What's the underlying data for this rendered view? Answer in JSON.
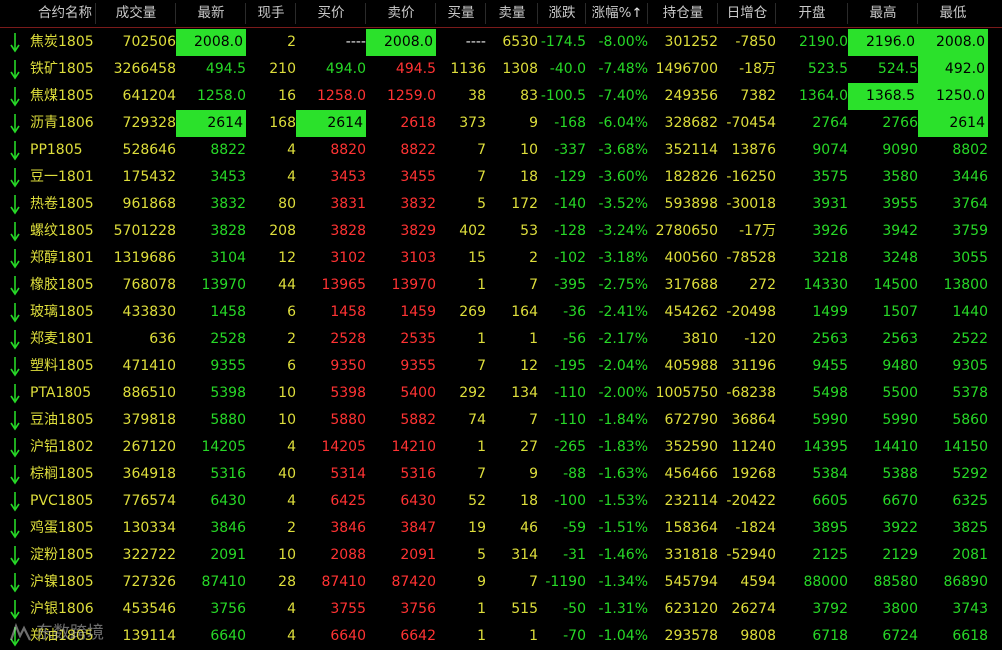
{
  "header": {
    "columns": [
      "合约名称",
      "成交量",
      "最新",
      "现手",
      "买价",
      "卖价",
      "买量",
      "卖量",
      "涨跌",
      "涨幅%",
      "持仓量",
      "日增仓",
      "开盘",
      "最高",
      "最低"
    ],
    "sort_indicator": "↑"
  },
  "rows": [
    {
      "name": "焦炭1805",
      "vol": "702506",
      "last": "2008.0",
      "hand": "2",
      "bid": "----",
      "ask": "2008.0",
      "bidv": "----",
      "askv": "6530",
      "chg": "-174.5",
      "pct": "-8.00%",
      "oi": "301252",
      "doi": "-7850",
      "open": "2190.0",
      "high": "2196.0",
      "low": "2008.0"
    },
    {
      "name": "铁矿1805",
      "vol": "3266458",
      "last": "494.5",
      "hand": "210",
      "bid": "494.0",
      "ask": "494.5",
      "bidv": "1136",
      "askv": "1308",
      "chg": "-40.0",
      "pct": "-7.48%",
      "oi": "1496700",
      "doi": "-18万",
      "open": "523.5",
      "high": "524.5",
      "low": "492.0"
    },
    {
      "name": "焦煤1805",
      "vol": "641204",
      "last": "1258.0",
      "hand": "16",
      "bid": "1258.0",
      "ask": "1259.0",
      "bidv": "38",
      "askv": "83",
      "chg": "-100.5",
      "pct": "-7.40%",
      "oi": "249356",
      "doi": "7382",
      "open": "1364.0",
      "high": "1368.5",
      "low": "1250.0"
    },
    {
      "name": "沥青1806",
      "vol": "729328",
      "last": "2614",
      "hand": "168",
      "bid": "2614",
      "ask": "2618",
      "bidv": "373",
      "askv": "9",
      "chg": "-168",
      "pct": "-6.04%",
      "oi": "328682",
      "doi": "-70454",
      "open": "2764",
      "high": "2766",
      "low": "2614"
    },
    {
      "name": "PP1805",
      "vol": "528646",
      "last": "8822",
      "hand": "4",
      "bid": "8820",
      "ask": "8822",
      "bidv": "7",
      "askv": "10",
      "chg": "-337",
      "pct": "-3.68%",
      "oi": "352114",
      "doi": "13876",
      "open": "9074",
      "high": "9090",
      "low": "8802"
    },
    {
      "name": "豆一1801",
      "vol": "175432",
      "last": "3453",
      "hand": "4",
      "bid": "3453",
      "ask": "3455",
      "bidv": "7",
      "askv": "18",
      "chg": "-129",
      "pct": "-3.60%",
      "oi": "182826",
      "doi": "-16250",
      "open": "3575",
      "high": "3580",
      "low": "3446"
    },
    {
      "name": "热卷1805",
      "vol": "961868",
      "last": "3832",
      "hand": "80",
      "bid": "3831",
      "ask": "3832",
      "bidv": "5",
      "askv": "172",
      "chg": "-140",
      "pct": "-3.52%",
      "oi": "593898",
      "doi": "-30018",
      "open": "3931",
      "high": "3955",
      "low": "3764"
    },
    {
      "name": "螺纹1805",
      "vol": "5701228",
      "last": "3828",
      "hand": "208",
      "bid": "3828",
      "ask": "3829",
      "bidv": "402",
      "askv": "53",
      "chg": "-128",
      "pct": "-3.24%",
      "oi": "2780650",
      "doi": "-17万",
      "open": "3926",
      "high": "3942",
      "low": "3759"
    },
    {
      "name": "郑醇1801",
      "vol": "1319686",
      "last": "3104",
      "hand": "12",
      "bid": "3102",
      "ask": "3103",
      "bidv": "15",
      "askv": "2",
      "chg": "-102",
      "pct": "-3.18%",
      "oi": "400560",
      "doi": "-78528",
      "open": "3218",
      "high": "3248",
      "low": "3055"
    },
    {
      "name": "橡胶1805",
      "vol": "768078",
      "last": "13970",
      "hand": "44",
      "bid": "13965",
      "ask": "13970",
      "bidv": "1",
      "askv": "7",
      "chg": "-395",
      "pct": "-2.75%",
      "oi": "317688",
      "doi": "272",
      "open": "14330",
      "high": "14500",
      "low": "13800"
    },
    {
      "name": "玻璃1805",
      "vol": "433830",
      "last": "1458",
      "hand": "6",
      "bid": "1458",
      "ask": "1459",
      "bidv": "269",
      "askv": "164",
      "chg": "-36",
      "pct": "-2.41%",
      "oi": "454262",
      "doi": "-20498",
      "open": "1499",
      "high": "1507",
      "low": "1440"
    },
    {
      "name": "郑麦1801",
      "vol": "636",
      "last": "2528",
      "hand": "2",
      "bid": "2528",
      "ask": "2535",
      "bidv": "1",
      "askv": "1",
      "chg": "-56",
      "pct": "-2.17%",
      "oi": "3810",
      "doi": "-120",
      "open": "2563",
      "high": "2563",
      "low": "2522"
    },
    {
      "name": "塑料1805",
      "vol": "471410",
      "last": "9355",
      "hand": "6",
      "bid": "9350",
      "ask": "9355",
      "bidv": "7",
      "askv": "12",
      "chg": "-195",
      "pct": "-2.04%",
      "oi": "405988",
      "doi": "31196",
      "open": "9455",
      "high": "9480",
      "low": "9305"
    },
    {
      "name": "PTA1805",
      "vol": "886510",
      "last": "5398",
      "hand": "10",
      "bid": "5398",
      "ask": "5400",
      "bidv": "292",
      "askv": "134",
      "chg": "-110",
      "pct": "-2.00%",
      "oi": "1005750",
      "doi": "-68238",
      "open": "5498",
      "high": "5500",
      "low": "5378"
    },
    {
      "name": "豆油1805",
      "vol": "379818",
      "last": "5880",
      "hand": "10",
      "bid": "5880",
      "ask": "5882",
      "bidv": "74",
      "askv": "7",
      "chg": "-110",
      "pct": "-1.84%",
      "oi": "672790",
      "doi": "36864",
      "open": "5990",
      "high": "5990",
      "low": "5860"
    },
    {
      "name": "沪铝1802",
      "vol": "267120",
      "last": "14205",
      "hand": "4",
      "bid": "14205",
      "ask": "14210",
      "bidv": "1",
      "askv": "27",
      "chg": "-265",
      "pct": "-1.83%",
      "oi": "352590",
      "doi": "11240",
      "open": "14395",
      "high": "14410",
      "low": "14150"
    },
    {
      "name": "棕榈1805",
      "vol": "364918",
      "last": "5316",
      "hand": "40",
      "bid": "5314",
      "ask": "5316",
      "bidv": "7",
      "askv": "9",
      "chg": "-88",
      "pct": "-1.63%",
      "oi": "456466",
      "doi": "19268",
      "open": "5384",
      "high": "5388",
      "low": "5292"
    },
    {
      "name": "PVC1805",
      "vol": "776574",
      "last": "6430",
      "hand": "4",
      "bid": "6425",
      "ask": "6430",
      "bidv": "52",
      "askv": "18",
      "chg": "-100",
      "pct": "-1.53%",
      "oi": "232114",
      "doi": "-20422",
      "open": "6605",
      "high": "6670",
      "low": "6325"
    },
    {
      "name": "鸡蛋1805",
      "vol": "130334",
      "last": "3846",
      "hand": "2",
      "bid": "3846",
      "ask": "3847",
      "bidv": "19",
      "askv": "46",
      "chg": "-59",
      "pct": "-1.51%",
      "oi": "158364",
      "doi": "-1824",
      "open": "3895",
      "high": "3922",
      "low": "3825"
    },
    {
      "name": "淀粉1805",
      "vol": "322722",
      "last": "2091",
      "hand": "10",
      "bid": "2088",
      "ask": "2091",
      "bidv": "5",
      "askv": "314",
      "chg": "-31",
      "pct": "-1.46%",
      "oi": "331818",
      "doi": "-52940",
      "open": "2125",
      "high": "2129",
      "low": "2081"
    },
    {
      "name": "沪镍1805",
      "vol": "727326",
      "last": "87410",
      "hand": "28",
      "bid": "87410",
      "ask": "87420",
      "bidv": "9",
      "askv": "7",
      "chg": "-1190",
      "pct": "-1.34%",
      "oi": "545794",
      "doi": "4594",
      "open": "88000",
      "high": "88580",
      "low": "86890"
    },
    {
      "name": "沪银1806",
      "vol": "453546",
      "last": "3756",
      "hand": "4",
      "bid": "3755",
      "ask": "3756",
      "bidv": "1",
      "askv": "515",
      "chg": "-50",
      "pct": "-1.31%",
      "oi": "623120",
      "doi": "26274",
      "open": "3792",
      "high": "3800",
      "low": "3743"
    },
    {
      "name": "郑油1805",
      "vol": "139114",
      "last": "6640",
      "hand": "4",
      "bid": "6640",
      "ask": "6642",
      "bidv": "1",
      "askv": "1",
      "chg": "-70",
      "pct": "-1.04%",
      "oi": "293578",
      "doi": "9808",
      "open": "6718",
      "high": "6724",
      "low": "6618"
    }
  ],
  "highlights": [
    {
      "row": 0,
      "cols": [
        "last",
        "ask",
        "high",
        "low"
      ]
    },
    {
      "row": 1,
      "cols": [
        "low"
      ]
    },
    {
      "row": 2,
      "cols": [
        "high",
        "low"
      ]
    },
    {
      "row": 3,
      "cols": [
        "last",
        "bid",
        "low"
      ]
    }
  ],
  "watermark": {
    "text": "东数跨境"
  },
  "colors": {
    "name": "#dede3c",
    "up": "#ff3333",
    "down": "#27d827",
    "neutral": "#e8e8e8",
    "highlight": "#2be12b",
    "grid_line": "#7a1a1a"
  }
}
